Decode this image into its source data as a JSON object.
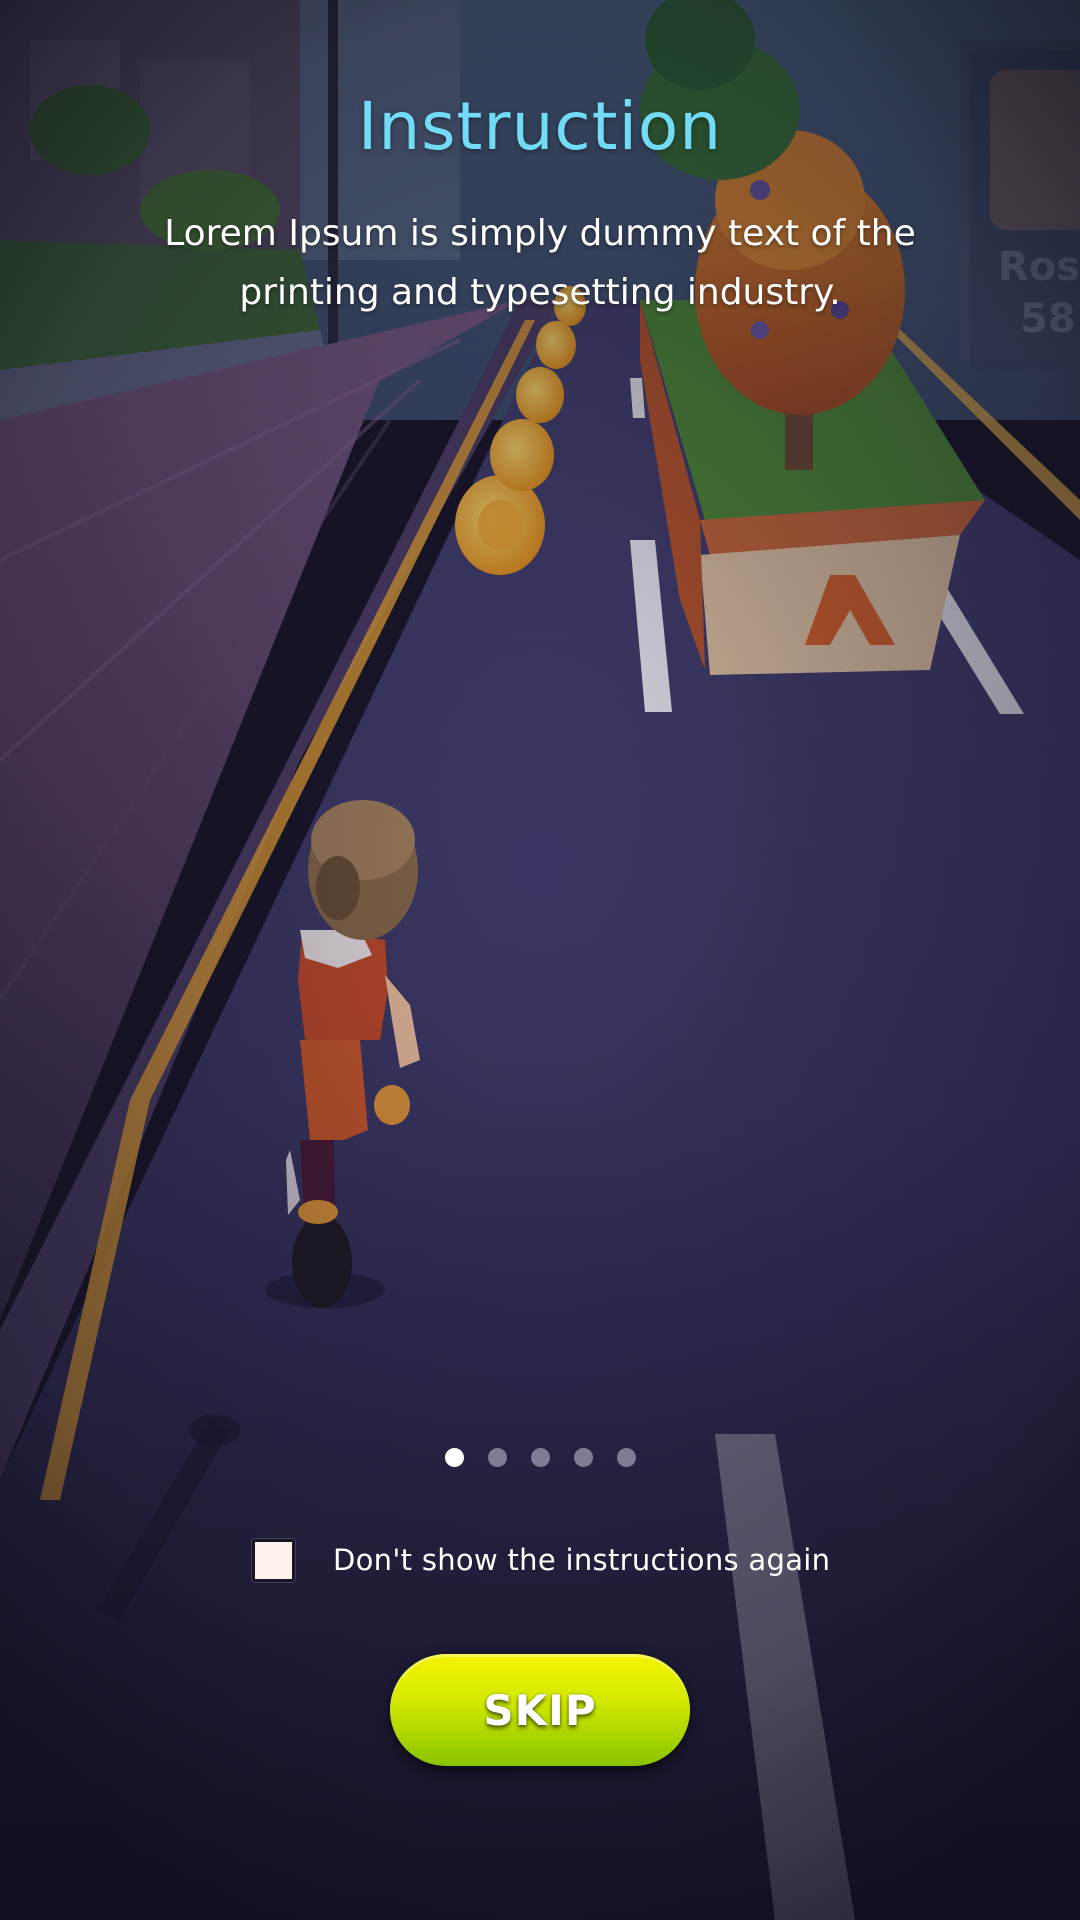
{
  "screen": {
    "title": "Instruction",
    "description": "Lorem Ipsum is simply dummy text of the printing and typesetting industry.",
    "pagination": {
      "total": 5,
      "active_index": 0
    },
    "dont_show_again": {
      "label": "Don't show the instructions again",
      "checked": false
    },
    "skip_button": {
      "label": "SKIP"
    },
    "sign": {
      "line1": "Ros",
      "line2": "58"
    }
  },
  "colors": {
    "title": "#72dcf7",
    "skip_button_top": "#f4f400",
    "skip_button_bottom": "#8ac400",
    "road": "#3e3a66",
    "lane_line": "#f1a93a"
  },
  "icons": {
    "background": "running-game-scene",
    "character": "runner-girl-icon",
    "coins": "gold-coin-icon"
  }
}
